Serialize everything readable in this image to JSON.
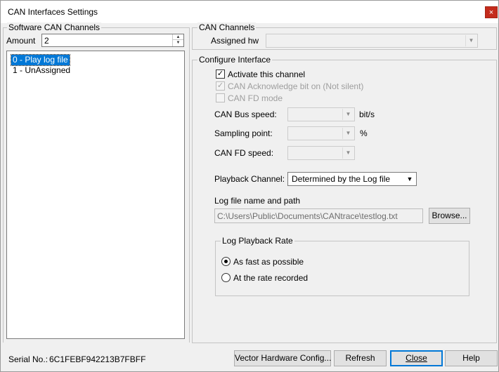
{
  "window": {
    "title": "CAN Interfaces Settings",
    "close_glyph": "×"
  },
  "software_channels": {
    "legend": "Software CAN Channels",
    "amount_label": "Amount",
    "amount_value": "2",
    "items": [
      {
        "label": "0 - Play log file",
        "selected": true
      },
      {
        "label": "1 - UnAssigned",
        "selected": false
      }
    ]
  },
  "can_channels": {
    "legend": "CAN Channels",
    "assigned_hw_label": "Assigned hw",
    "assigned_hw_value": ""
  },
  "configure": {
    "legend": "Configure Interface",
    "activate_label": "Activate this channel",
    "activate_checked": true,
    "ack_label": "CAN Acknowledge bit on (Not silent)",
    "ack_checked": true,
    "fd_label": "CAN FD mode",
    "fd_checked": false,
    "bus_speed_label": "CAN Bus speed:",
    "bus_speed_unit": "bit/s",
    "sampling_label": "Sampling point:",
    "sampling_unit": "%",
    "fd_speed_label": "CAN FD speed:",
    "playback_label": "Playback Channel:",
    "playback_value": "Determined by the Log file",
    "logfile_label": "Log file name and path",
    "logfile_value": "C:\\Users\\Public\\Documents\\CANtrace\\testlog.txt",
    "browse_label": "Browse...",
    "rate": {
      "legend": "Log Playback Rate",
      "options": [
        {
          "label": "As fast as possible",
          "selected": true
        },
        {
          "label": "At the rate recorded",
          "selected": false
        }
      ]
    }
  },
  "footer": {
    "serial_label": "Serial No.:",
    "serial_value": "6C1FEBF942213B7FBFF",
    "vector_label": "Vector Hardware Config...",
    "refresh_label": "Refresh",
    "close_label": "Close",
    "help_label": "Help"
  },
  "icons": {
    "check": "✓",
    "spin_up": "▲",
    "spin_down": "▼",
    "dropdown": "▼"
  }
}
